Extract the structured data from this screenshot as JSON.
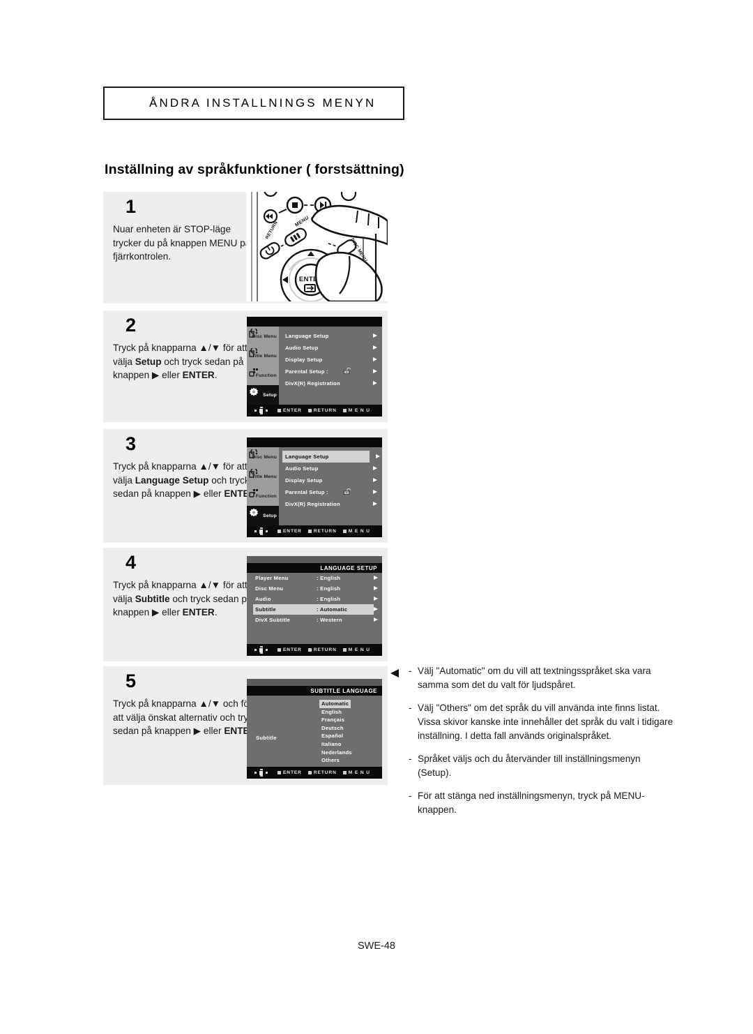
{
  "header": {
    "chapter": "ÅNDRA INSTALLNINGS MENYN",
    "title": "Inställning av språkfunktioner ( forstsättning)"
  },
  "footer": {
    "page": "SWE-48"
  },
  "steps": [
    {
      "number": "1",
      "text_parts": [
        {
          "t": "Nuar enheten är STOP-läge trycker du på knappen MENU på fjärrkontrolen.",
          "b": false
        }
      ],
      "art": "remote-control"
    },
    {
      "number": "2",
      "text_parts": [
        {
          "t": "Tryck på knapparna ▲/▼ för att välja ",
          "b": false
        },
        {
          "t": "Setup",
          "b": true
        },
        {
          "t": " och tryck sedan på knappen ▶ eller ",
          "b": false
        },
        {
          "t": "ENTER",
          "b": true
        },
        {
          "t": ".",
          "b": false
        }
      ],
      "art": "setup-menu"
    },
    {
      "number": "3",
      "text_parts": [
        {
          "t": "Tryck på knapparna ▲/▼ för att välja ",
          "b": false
        },
        {
          "t": "Language Setup",
          "b": true
        },
        {
          "t": " och tryck sedan på knappen ▶ eller ",
          "b": false
        },
        {
          "t": "ENTER",
          "b": true
        },
        {
          "t": ".",
          "b": false
        }
      ],
      "art": "setup-menu-highlighted"
    },
    {
      "number": "4",
      "text_parts": [
        {
          "t": "Tryck på knapparna ▲/▼ för att välja ",
          "b": false
        },
        {
          "t": "Subtitle",
          "b": true
        },
        {
          "t": " och tryck sedan på knappen ▶ eller ",
          "b": false
        },
        {
          "t": "ENTER",
          "b": true
        },
        {
          "t": ".",
          "b": false
        }
      ],
      "art": "language-setup-menu"
    },
    {
      "number": "5",
      "text_parts": [
        {
          "t": "Tryck på knapparna ▲/▼ och för att välja önskat alternativ och tryck sedan på knappen ▶ eller ",
          "b": false
        },
        {
          "t": "ENTER",
          "b": true
        },
        {
          "t": ".",
          "b": false
        }
      ],
      "art": "subtitle-language-menu"
    }
  ],
  "osd": {
    "sidebar": [
      {
        "label": "Disc Menu",
        "icon": "disc-menu-icon",
        "selected": false
      },
      {
        "label": "Title Menu",
        "icon": "title-menu-icon",
        "selected": false
      },
      {
        "label": "Function",
        "icon": "function-icon",
        "selected": false
      },
      {
        "label": "Setup",
        "icon": "gear-icon",
        "selected": true
      }
    ],
    "setup_rows": [
      {
        "label": "Language Setup",
        "highlighted": false,
        "lock": false
      },
      {
        "label": "Audio Setup",
        "highlighted": false,
        "lock": false
      },
      {
        "label": "Display Setup",
        "highlighted": false,
        "lock": false
      },
      {
        "label": "Parental Setup :",
        "highlighted": false,
        "lock": true
      },
      {
        "label": "DivX(R) Registration",
        "highlighted": false,
        "lock": false
      }
    ],
    "setup_rows_highlighted": [
      {
        "label": "Language Setup",
        "highlighted": true,
        "lock": false
      },
      {
        "label": "Audio Setup",
        "highlighted": false,
        "lock": false
      },
      {
        "label": "Display Setup",
        "highlighted": false,
        "lock": false
      },
      {
        "label": "Parental Setup :",
        "highlighted": false,
        "lock": true
      },
      {
        "label": "DivX(R) Registration",
        "highlighted": false,
        "lock": false
      }
    ],
    "language_setup": {
      "title": "LANGUAGE SETUP",
      "rows": [
        {
          "name": "Player Menu",
          "value": ": English",
          "highlighted": false
        },
        {
          "name": "Disc Menu",
          "value": ": English",
          "highlighted": false
        },
        {
          "name": "Audio",
          "value": ": English",
          "highlighted": false
        },
        {
          "name": "Subtitle",
          "value": ": Automatic",
          "highlighted": true
        },
        {
          "name": "DivX Subtitle",
          "value": ": Western",
          "highlighted": false
        }
      ]
    },
    "subtitle_language": {
      "title": "SUBTITLE LANGUAGE",
      "label": "Subtitle",
      "options": [
        {
          "label": "Automatic",
          "highlighted": true
        },
        {
          "label": "English",
          "highlighted": false
        },
        {
          "label": "Français",
          "highlighted": false
        },
        {
          "label": "Deutsch",
          "highlighted": false
        },
        {
          "label": "Español",
          "highlighted": false
        },
        {
          "label": "Italiano",
          "highlighted": false
        },
        {
          "label": "Nederlands",
          "highlighted": false
        },
        {
          "label": "Others",
          "highlighted": false
        }
      ]
    },
    "hints": [
      {
        "label": "ENTER"
      },
      {
        "label": "RETURN"
      },
      {
        "label": "M E N U"
      }
    ]
  },
  "notes": [
    {
      "dash": "-",
      "text": "Välj \"Automatic\" om du vill att textningsspråket ska vara samma som det du valt för ljudspåret.",
      "pointer": true
    },
    {
      "dash": "-",
      "text": "Välj \"Others\" om det språk du vill använda inte finns listat. Vissa skivor kanske inte innehåller det språk du valt i tidigare inställning. I detta fall används originalspråket.",
      "pointer": false
    },
    {
      "dash": "-",
      "text": "Språket väljs och du återvänder till inställningsmenyn (Setup).",
      "pointer": false
    },
    {
      "dash": "-",
      "text": "För att stänga ned inställningsmenyn, tryck på MENU-knappen.",
      "pointer": false
    }
  ]
}
